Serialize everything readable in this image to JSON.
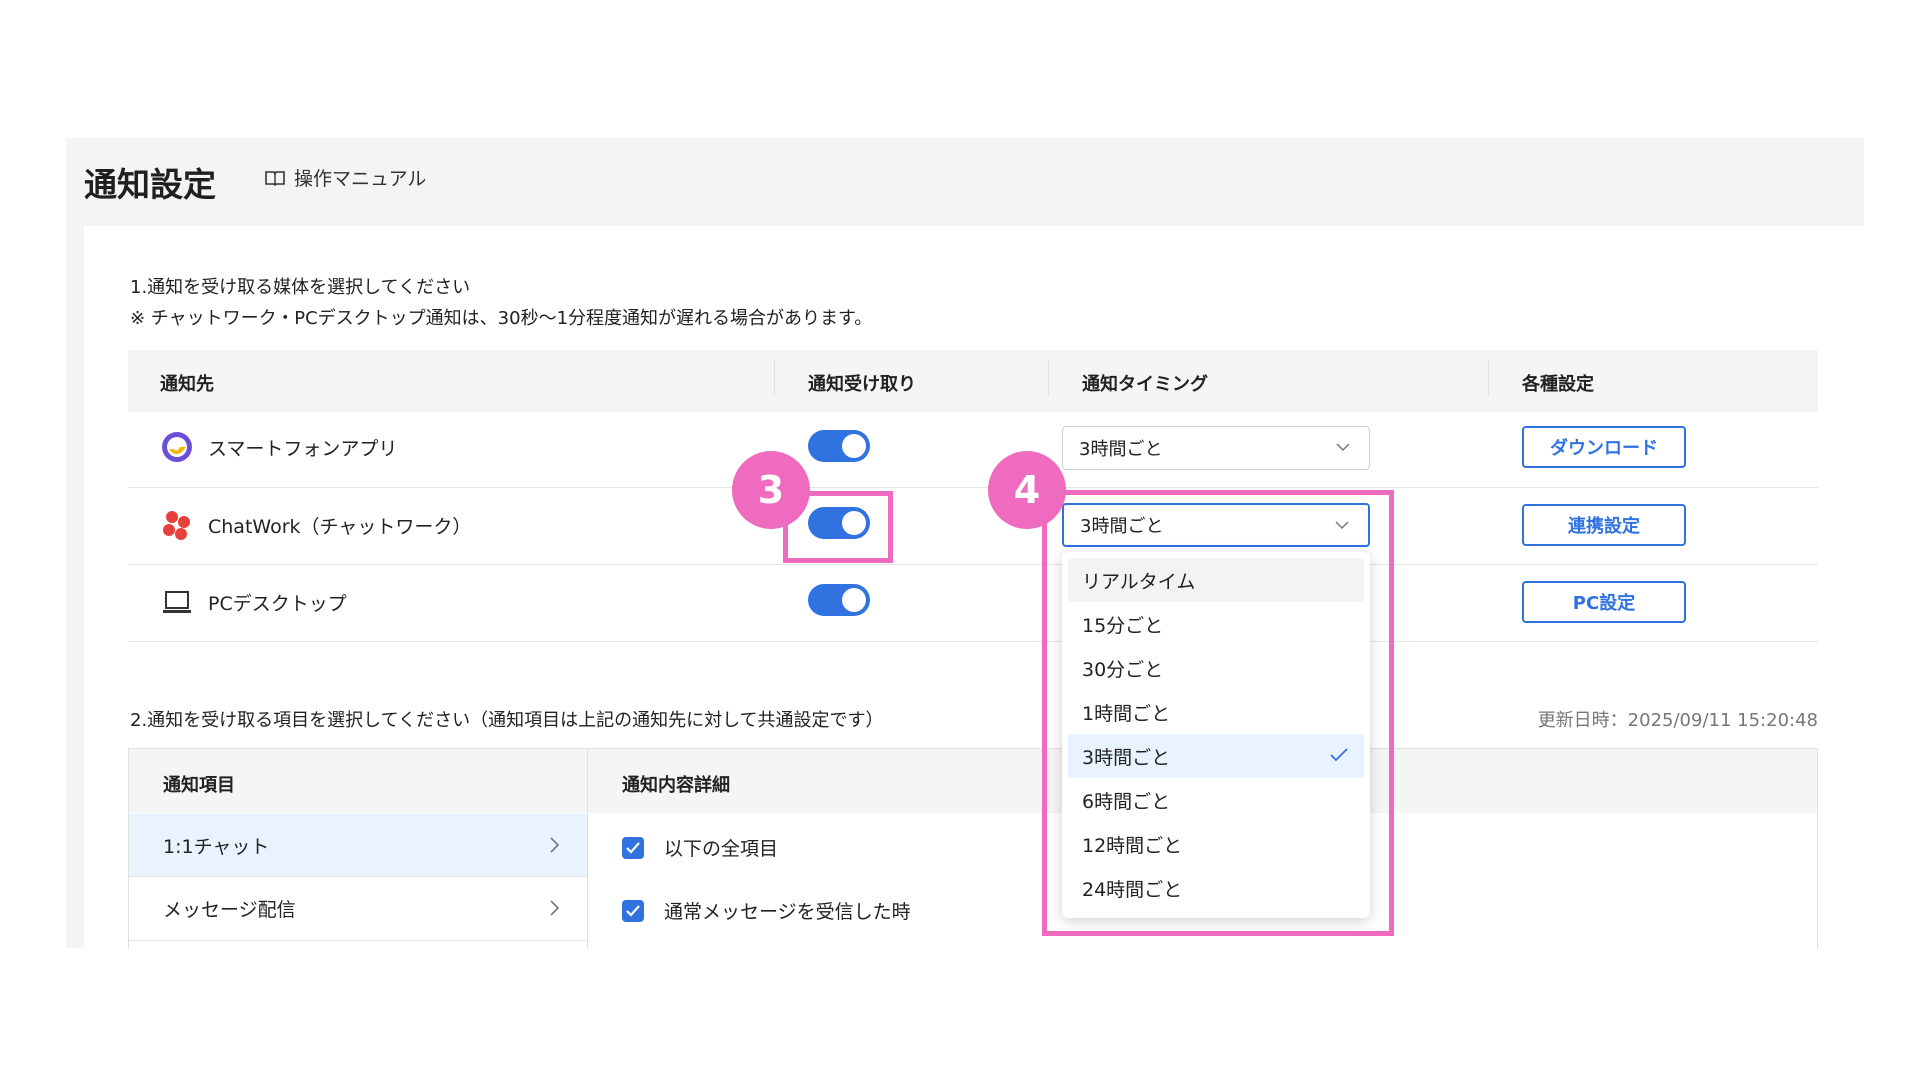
{
  "header": {
    "title": "通知設定",
    "manual_link": "操作マニュアル",
    "manual_icon": "book-icon"
  },
  "section1": {
    "title": "1.通知を受け取る媒体を選択してください",
    "note": "※ チャットワーク・PCデスクトップ通知は、30秒〜1分程度通知が遅れる場合があります。",
    "columns": [
      "通知先",
      "通知受け取り",
      "通知タイミング",
      "各種設定"
    ],
    "rows": [
      {
        "name": "スマートフォンアプリ",
        "icon": "smartphone-app-logo-icon",
        "enabled": true,
        "timing": "3時間ごと",
        "button": "ダウンロード"
      },
      {
        "name": "ChatWork（チャットワーク）",
        "icon": "chatwork-logo-icon",
        "enabled": true,
        "timing": "3時間ごと",
        "button": "連携設定"
      },
      {
        "name": "PCデスクトップ",
        "icon": "laptop-icon",
        "enabled": true,
        "timing": "",
        "button": "PC設定"
      }
    ]
  },
  "dropdown": {
    "options": [
      "リアルタイム",
      "15分ごと",
      "30分ごと",
      "1時間ごと",
      "3時間ごと",
      "6時間ごと",
      "12時間ごと",
      "24時間ごと"
    ],
    "selected": "3時間ごと",
    "hovered": "リアルタイム"
  },
  "section2": {
    "title": "2.通知を受け取る項目を選択してください（通知項目は上記の通知先に対して共通設定です）",
    "updated": "更新日時：2025/09/11 15:20:48",
    "columns": [
      "通知項目",
      "通知内容詳細"
    ],
    "items": [
      "1:1チャット",
      "メッセージ配信"
    ],
    "details": [
      {
        "label": "以下の全項目",
        "checked": true
      },
      {
        "label": "通常メッセージを受信した時",
        "checked": true
      }
    ]
  },
  "annotations": {
    "marker3": "3",
    "marker4": "4"
  },
  "colors": {
    "accent": "#2f72e0",
    "highlight": "#ee6bbf",
    "selected_bg": "#e9f3ff"
  }
}
